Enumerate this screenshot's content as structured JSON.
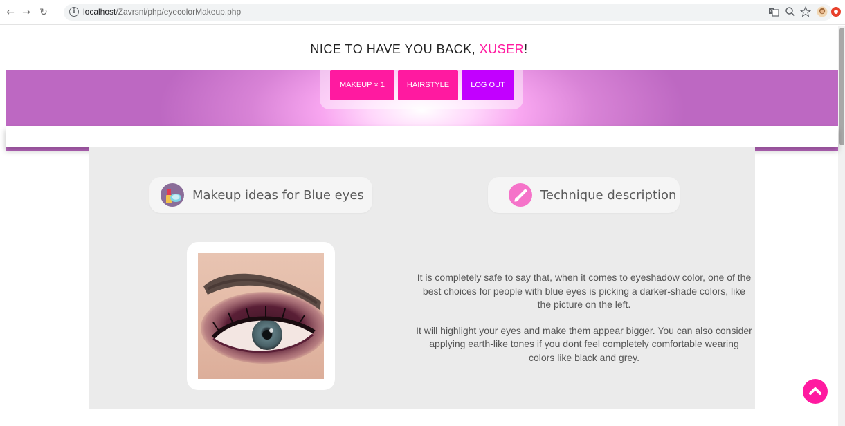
{
  "browser": {
    "url_host": "localhost",
    "url_path": "/Zavrsni/php/eyecolorMakeup.php"
  },
  "header": {
    "welcome_prefix": "NICE TO HAVE YOU BACK, ",
    "username": "XUSER",
    "welcome_suffix": "!"
  },
  "menu": {
    "makeup": "MAKEUP × 1",
    "hairstyle": "HAIRSTYLE",
    "logout": "LOG OUT"
  },
  "sections": {
    "ideas_title": "Makeup ideas for Blue eyes",
    "technique_title": "Technique description"
  },
  "description": {
    "paragraph1": "It is completely safe to say that, when it comes to eyeshadow color, one of the best choices for people with blue eyes is picking a darker-shade colors, like the picture on the left.",
    "paragraph2": "It will highlight your eyes and make them appear bigger. You can also consider applying earth-like tones if you dont feel completely comfortable wearing colors like black and grey."
  },
  "colors": {
    "accent_pink": "#ff1aa0",
    "accent_purple": "#c200ff",
    "content_bg": "#ebebeb"
  },
  "icons": {
    "back": "arrow-left-icon",
    "forward": "arrow-right-icon",
    "reload": "reload-icon",
    "site_info": "info-icon",
    "translate": "translate-icon",
    "zoom": "zoom-icon",
    "bookmark": "star-icon",
    "profile": "profile-avatar-icon",
    "extension": "extension-icon",
    "makeup_pill": "cosmetics-icon",
    "technique_pill": "brush-icon",
    "scroll_top": "chevron-up-icon"
  }
}
